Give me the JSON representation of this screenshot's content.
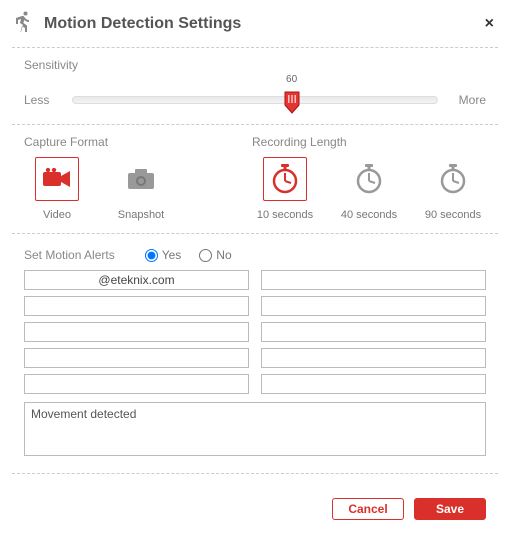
{
  "header": {
    "title": "Motion Detection Settings"
  },
  "sensitivity": {
    "label": "Sensitivity",
    "less": "Less",
    "more": "More",
    "value": 60,
    "percent": 60
  },
  "capture": {
    "label": "Capture Format",
    "options": [
      {
        "id": "video",
        "label": "Video",
        "selected": true
      },
      {
        "id": "snapshot",
        "label": "Snapshot",
        "selected": false
      }
    ]
  },
  "recording": {
    "label": "Recording Length",
    "options": [
      {
        "id": "10",
        "label": "10 seconds",
        "selected": true
      },
      {
        "id": "40",
        "label": "40 seconds",
        "selected": false
      },
      {
        "id": "90",
        "label": "90 seconds",
        "selected": false
      }
    ]
  },
  "alerts": {
    "label": "Set Motion Alerts",
    "yes": "Yes",
    "no": "No",
    "selected": "yes",
    "emails": [
      "@eteknix.com",
      "",
      "",
      "",
      "",
      "",
      "",
      "",
      "",
      ""
    ],
    "message": "Movement detected"
  },
  "footer": {
    "cancel": "Cancel",
    "save": "Save"
  },
  "colors": {
    "accent": "#d9302c"
  }
}
